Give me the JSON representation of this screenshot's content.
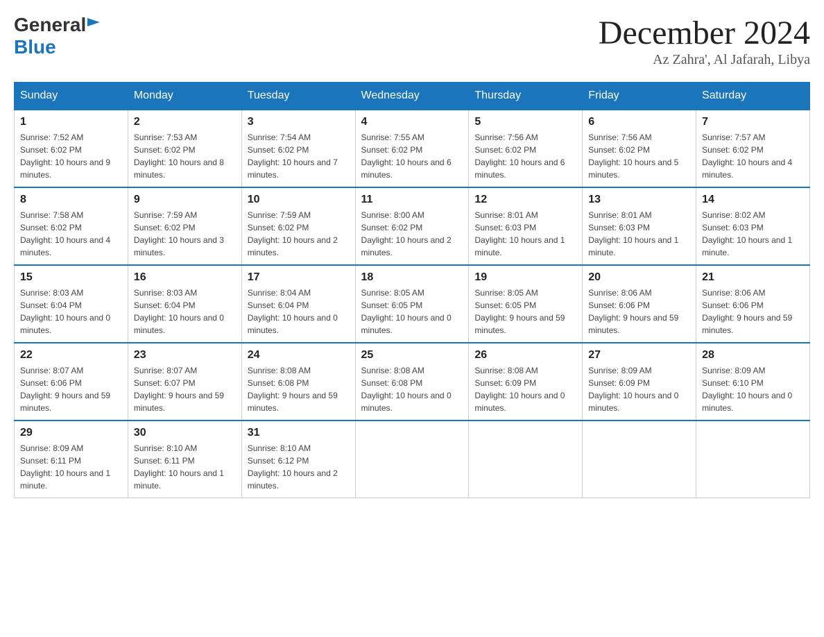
{
  "header": {
    "logo_general": "General",
    "logo_blue": "Blue",
    "month_year": "December 2024",
    "location": "Az Zahra', Al Jafarah, Libya"
  },
  "days_of_week": [
    "Sunday",
    "Monday",
    "Tuesday",
    "Wednesday",
    "Thursday",
    "Friday",
    "Saturday"
  ],
  "weeks": [
    [
      {
        "day": "1",
        "sunrise": "7:52 AM",
        "sunset": "6:02 PM",
        "daylight": "10 hours and 9 minutes."
      },
      {
        "day": "2",
        "sunrise": "7:53 AM",
        "sunset": "6:02 PM",
        "daylight": "10 hours and 8 minutes."
      },
      {
        "day": "3",
        "sunrise": "7:54 AM",
        "sunset": "6:02 PM",
        "daylight": "10 hours and 7 minutes."
      },
      {
        "day": "4",
        "sunrise": "7:55 AM",
        "sunset": "6:02 PM",
        "daylight": "10 hours and 6 minutes."
      },
      {
        "day": "5",
        "sunrise": "7:56 AM",
        "sunset": "6:02 PM",
        "daylight": "10 hours and 6 minutes."
      },
      {
        "day": "6",
        "sunrise": "7:56 AM",
        "sunset": "6:02 PM",
        "daylight": "10 hours and 5 minutes."
      },
      {
        "day": "7",
        "sunrise": "7:57 AM",
        "sunset": "6:02 PM",
        "daylight": "10 hours and 4 minutes."
      }
    ],
    [
      {
        "day": "8",
        "sunrise": "7:58 AM",
        "sunset": "6:02 PM",
        "daylight": "10 hours and 4 minutes."
      },
      {
        "day": "9",
        "sunrise": "7:59 AM",
        "sunset": "6:02 PM",
        "daylight": "10 hours and 3 minutes."
      },
      {
        "day": "10",
        "sunrise": "7:59 AM",
        "sunset": "6:02 PM",
        "daylight": "10 hours and 2 minutes."
      },
      {
        "day": "11",
        "sunrise": "8:00 AM",
        "sunset": "6:02 PM",
        "daylight": "10 hours and 2 minutes."
      },
      {
        "day": "12",
        "sunrise": "8:01 AM",
        "sunset": "6:03 PM",
        "daylight": "10 hours and 1 minute."
      },
      {
        "day": "13",
        "sunrise": "8:01 AM",
        "sunset": "6:03 PM",
        "daylight": "10 hours and 1 minute."
      },
      {
        "day": "14",
        "sunrise": "8:02 AM",
        "sunset": "6:03 PM",
        "daylight": "10 hours and 1 minute."
      }
    ],
    [
      {
        "day": "15",
        "sunrise": "8:03 AM",
        "sunset": "6:04 PM",
        "daylight": "10 hours and 0 minutes."
      },
      {
        "day": "16",
        "sunrise": "8:03 AM",
        "sunset": "6:04 PM",
        "daylight": "10 hours and 0 minutes."
      },
      {
        "day": "17",
        "sunrise": "8:04 AM",
        "sunset": "6:04 PM",
        "daylight": "10 hours and 0 minutes."
      },
      {
        "day": "18",
        "sunrise": "8:05 AM",
        "sunset": "6:05 PM",
        "daylight": "10 hours and 0 minutes."
      },
      {
        "day": "19",
        "sunrise": "8:05 AM",
        "sunset": "6:05 PM",
        "daylight": "9 hours and 59 minutes."
      },
      {
        "day": "20",
        "sunrise": "8:06 AM",
        "sunset": "6:06 PM",
        "daylight": "9 hours and 59 minutes."
      },
      {
        "day": "21",
        "sunrise": "8:06 AM",
        "sunset": "6:06 PM",
        "daylight": "9 hours and 59 minutes."
      }
    ],
    [
      {
        "day": "22",
        "sunrise": "8:07 AM",
        "sunset": "6:06 PM",
        "daylight": "9 hours and 59 minutes."
      },
      {
        "day": "23",
        "sunrise": "8:07 AM",
        "sunset": "6:07 PM",
        "daylight": "9 hours and 59 minutes."
      },
      {
        "day": "24",
        "sunrise": "8:08 AM",
        "sunset": "6:08 PM",
        "daylight": "9 hours and 59 minutes."
      },
      {
        "day": "25",
        "sunrise": "8:08 AM",
        "sunset": "6:08 PM",
        "daylight": "10 hours and 0 minutes."
      },
      {
        "day": "26",
        "sunrise": "8:08 AM",
        "sunset": "6:09 PM",
        "daylight": "10 hours and 0 minutes."
      },
      {
        "day": "27",
        "sunrise": "8:09 AM",
        "sunset": "6:09 PM",
        "daylight": "10 hours and 0 minutes."
      },
      {
        "day": "28",
        "sunrise": "8:09 AM",
        "sunset": "6:10 PM",
        "daylight": "10 hours and 0 minutes."
      }
    ],
    [
      {
        "day": "29",
        "sunrise": "8:09 AM",
        "sunset": "6:11 PM",
        "daylight": "10 hours and 1 minute."
      },
      {
        "day": "30",
        "sunrise": "8:10 AM",
        "sunset": "6:11 PM",
        "daylight": "10 hours and 1 minute."
      },
      {
        "day": "31",
        "sunrise": "8:10 AM",
        "sunset": "6:12 PM",
        "daylight": "10 hours and 2 minutes."
      },
      null,
      null,
      null,
      null
    ]
  ],
  "labels": {
    "sunrise": "Sunrise:",
    "sunset": "Sunset:",
    "daylight": "Daylight:"
  }
}
